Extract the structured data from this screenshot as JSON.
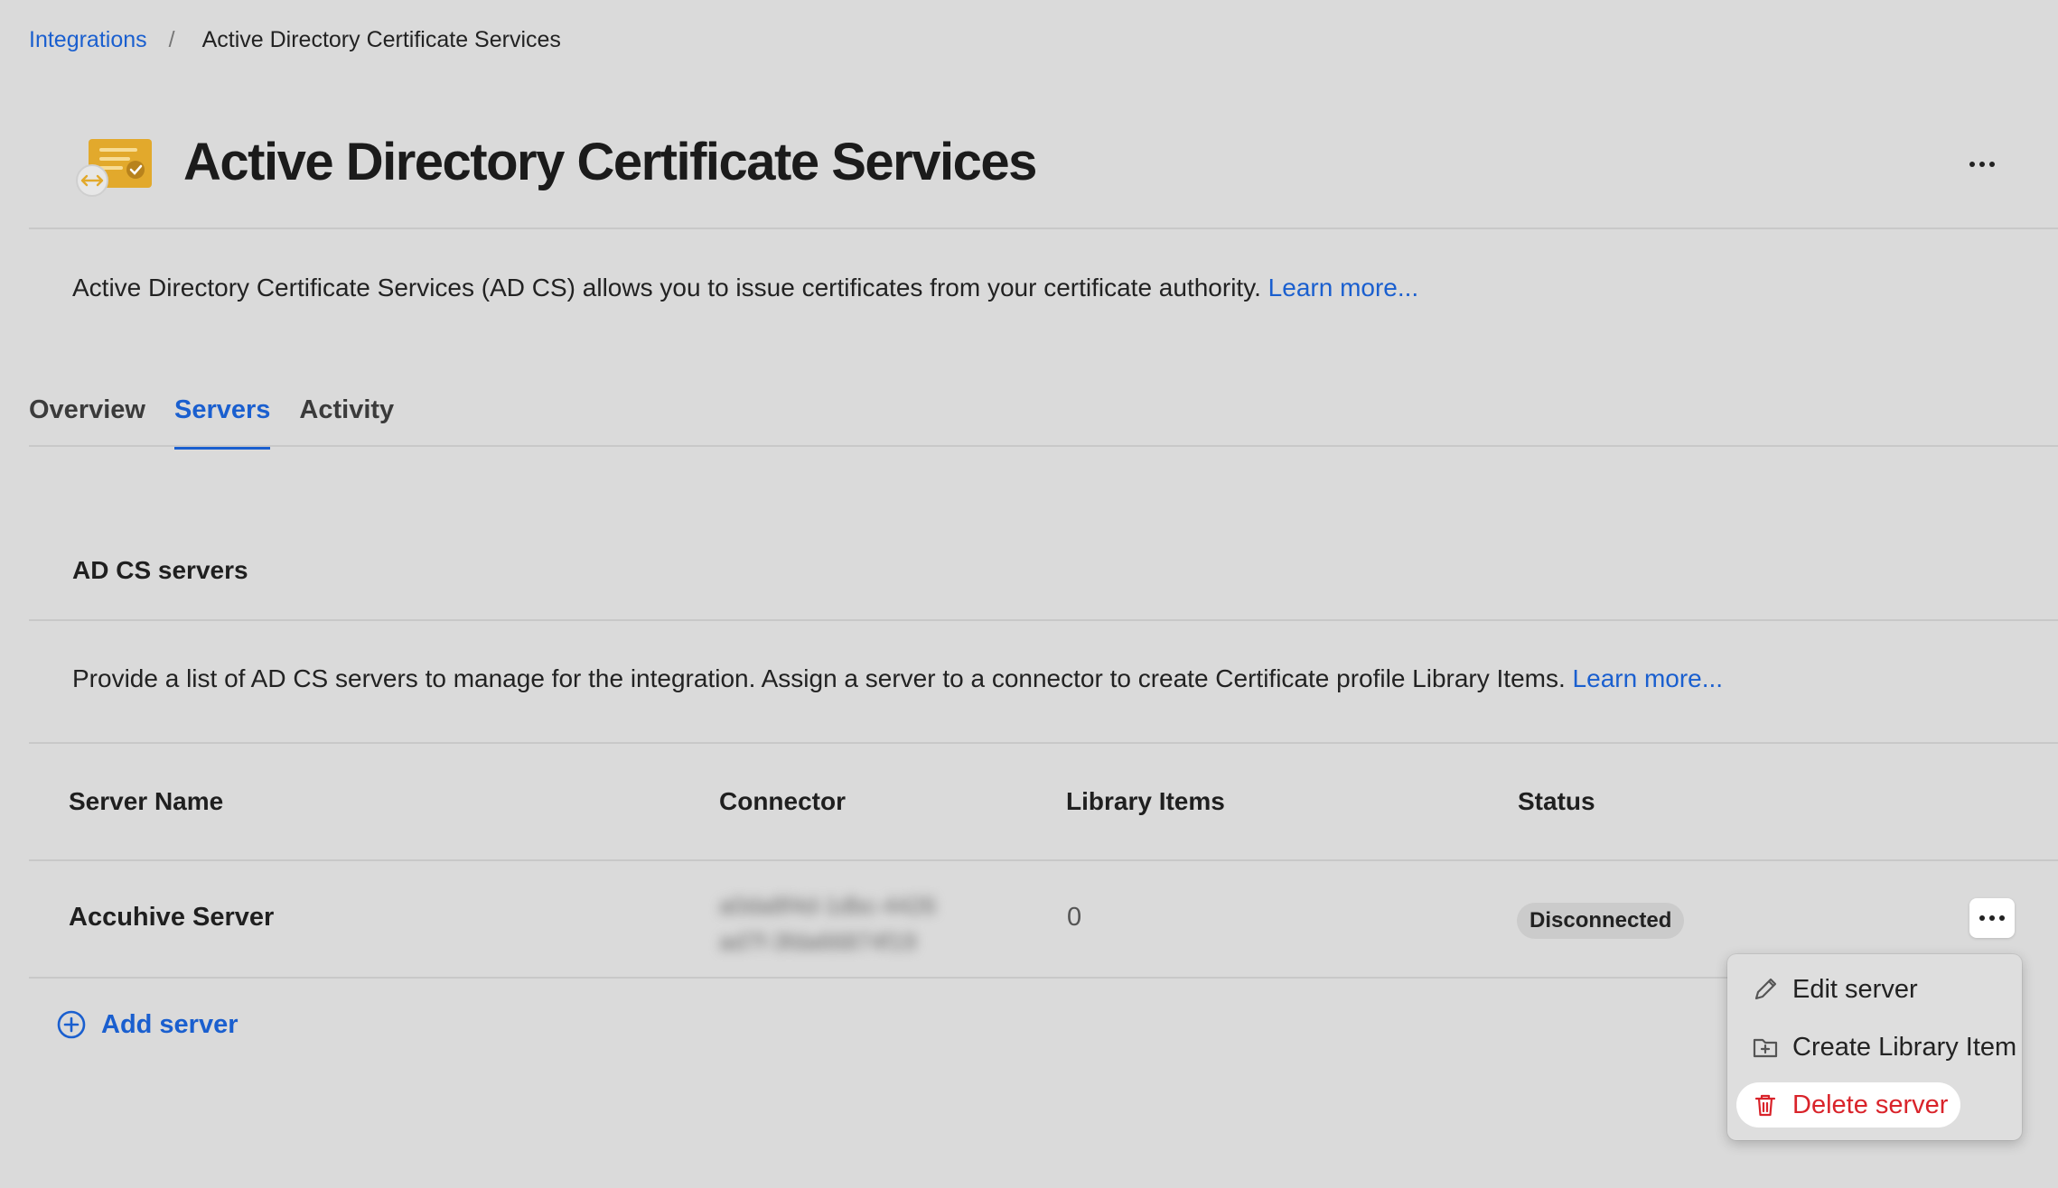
{
  "breadcrumb": {
    "parent": "Integrations",
    "separator": "/",
    "current": "Active Directory Certificate Services"
  },
  "header": {
    "title": "Active Directory Certificate Services",
    "icon": "certificate-icon",
    "more_icon": "ellipsis-icon"
  },
  "description": {
    "text": "Active Directory Certificate Services (AD CS) allows you to issue certificates from your certificate authority.",
    "link": "Learn more..."
  },
  "tabs": [
    {
      "label": "Overview",
      "active": false
    },
    {
      "label": "Servers",
      "active": true
    },
    {
      "label": "Activity",
      "active": false
    }
  ],
  "servers_section": {
    "title": "AD CS servers",
    "description": "Provide a list of AD CS servers to manage for the integration. Assign a server to a connector to create Certificate profile Library Items.",
    "link": "Learn more..."
  },
  "table": {
    "columns": [
      "Server Name",
      "Connector",
      "Library Items",
      "Status"
    ],
    "rows": [
      {
        "server_name": "Accuhive Server",
        "connector_line1": "a0da8f4d-1dbc-4426",
        "connector_line2": "ad7f-3fda66874f19",
        "library_items": "0",
        "status": "Disconnected"
      }
    ]
  },
  "add_server": {
    "label": "Add server",
    "icon": "plus-circle-icon"
  },
  "context_menu": {
    "items": [
      {
        "label": "Edit server",
        "icon": "pencil-icon"
      },
      {
        "label": "Create Library Item",
        "icon": "folder-plus-icon"
      },
      {
        "label": "Delete server",
        "icon": "trash-icon",
        "color": "#d9232a"
      }
    ]
  },
  "colors": {
    "background": "#dadada",
    "accent": "#1a5fcf",
    "danger": "#d9232a",
    "icon_gold": "#e2a92c"
  }
}
